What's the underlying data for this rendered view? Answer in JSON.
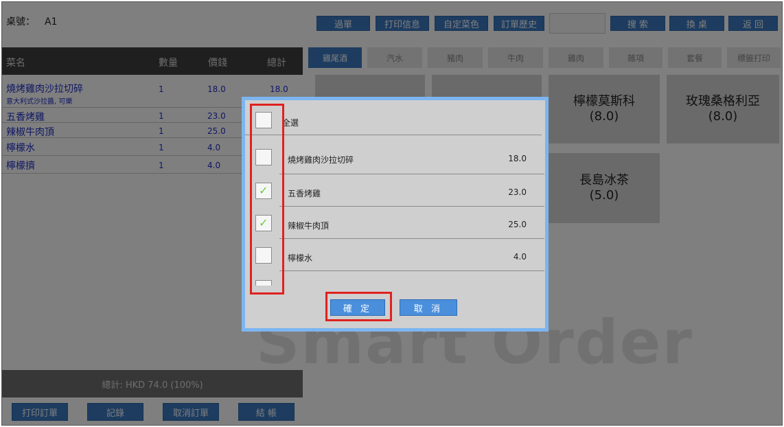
{
  "header": {
    "table_label": "桌號：",
    "table_value": "A1",
    "buttons": {
      "order": "過單",
      "print_info": "打印信息",
      "custom_dish": "自定菜色",
      "order_history": "訂單歷史",
      "search": "搜 索",
      "change_table": "換 桌",
      "back": "返 回"
    }
  },
  "order_table": {
    "columns": {
      "name": "菜名",
      "qty": "數量",
      "price": "價錢",
      "total": "總計"
    },
    "rows": [
      {
        "name": "燒烤雞肉沙拉切碎",
        "sub": "意大利式沙拉醬, 可樂",
        "qty": "1",
        "price": "18.0",
        "total": "18.0"
      },
      {
        "name": "五香烤雞",
        "qty": "1",
        "price": "23.0"
      },
      {
        "name": "辣椒牛肉頂",
        "qty": "1",
        "price": "25.0"
      },
      {
        "name": "檸檬水",
        "qty": "1",
        "price": "4.0"
      },
      {
        "name": "檸檬擠",
        "qty": "1",
        "price": "4.0"
      }
    ],
    "total_text": "總計:  HKD 74.0  (100%)"
  },
  "bottom_buttons": {
    "print_order": "打印訂單",
    "record": "記錄",
    "cancel_order": "取消訂單",
    "checkout": "結 帳"
  },
  "categories": [
    "雞尾酒",
    "汽水",
    "豬肉",
    "牛肉",
    "雞肉",
    "雜項",
    "套餐",
    "標籤打印"
  ],
  "menu_items": [
    {
      "name": "檸檬莫斯科",
      "price": "(8.0)"
    },
    {
      "name": "玫瑰桑格利亞",
      "price": "(8.0)"
    },
    {
      "name": "長島冰茶",
      "price": "(5.0)"
    }
  ],
  "watermark": "Smart Order",
  "dialog": {
    "select_all": "全選",
    "items": [
      {
        "name": "燒烤雞肉沙拉切碎",
        "price": "18.0",
        "checked": false
      },
      {
        "name": "五香烤雞",
        "price": "23.0",
        "checked": true
      },
      {
        "name": "辣椒牛肉頂",
        "price": "25.0",
        "checked": true
      },
      {
        "name": "檸檬水",
        "price": "4.0",
        "checked": false
      }
    ],
    "confirm": "確 定",
    "cancel": "取 消",
    "tick_char": "✓"
  },
  "colors": {
    "accent_blue": "#3a78c0",
    "dialog_border": "#7cb5f0",
    "highlight_red": "#e0211f",
    "check_green": "#6acb3a",
    "item_text": "#1e2ec8"
  }
}
